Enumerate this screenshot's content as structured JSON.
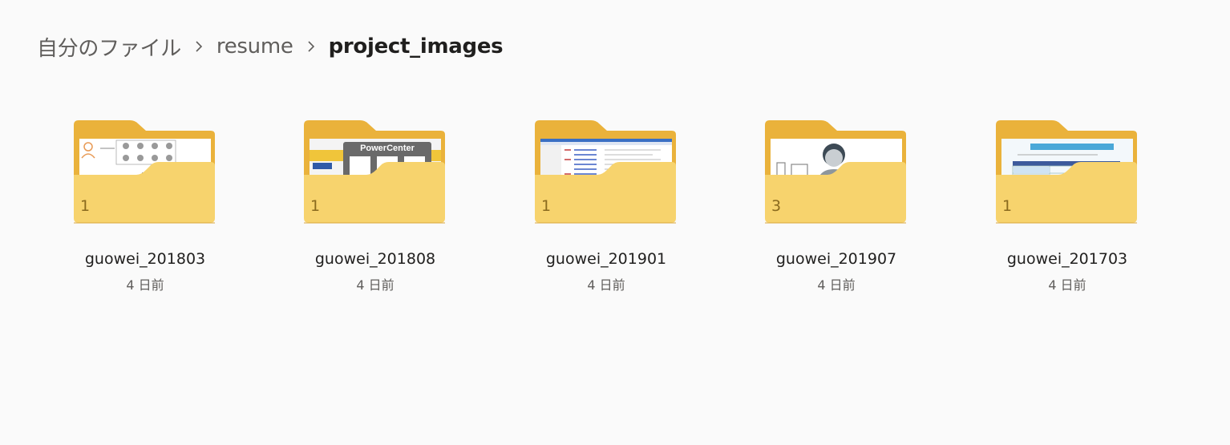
{
  "breadcrumb": {
    "items": [
      {
        "label": "自分のファイル"
      },
      {
        "label": "resume"
      },
      {
        "label": "project_images"
      }
    ]
  },
  "folders": [
    {
      "name": "guowei_201803",
      "count": "1",
      "modified": "4 日前"
    },
    {
      "name": "guowei_201808",
      "count": "1",
      "modified": "4 日前",
      "thumb_title": "PowerCenter"
    },
    {
      "name": "guowei_201901",
      "count": "1",
      "modified": "4 日前"
    },
    {
      "name": "guowei_201907",
      "count": "3",
      "modified": "4 日前"
    },
    {
      "name": "guowei_201703",
      "count": "1",
      "modified": "4 日前"
    }
  ],
  "colors": {
    "folder_back": "#eab23b",
    "folder_front": "#f7d36d",
    "background": "#fafafa"
  }
}
